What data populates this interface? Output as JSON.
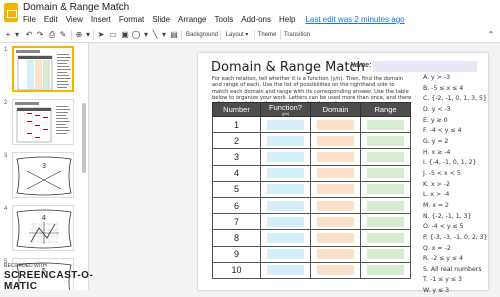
{
  "app": {
    "title": "Domain & Range Match",
    "menu": [
      "File",
      "Edit",
      "View",
      "Insert",
      "Format",
      "Slide",
      "Arrange",
      "Tools",
      "Add-ons",
      "Help"
    ],
    "last_edit": "Last edit was 2 minutes ago"
  },
  "toolbar": {
    "background": "Background",
    "layout": "Layout",
    "theme": "Theme",
    "transition": "Transition"
  },
  "filmstrip": {
    "slides": [
      {
        "number": "1",
        "selected": true
      },
      {
        "number": "2",
        "selected": false
      },
      {
        "number": "3",
        "selected": false
      },
      {
        "number": "4",
        "selected": false
      },
      {
        "number": "5",
        "selected": false
      }
    ]
  },
  "slide": {
    "title": "Domain & Range Match",
    "name_label": "Name:",
    "instructions": "For each relation, tell whether it is a function (y/n). Then, find the domain and range of each. Use the list of possibilities on the righthand side to match each domain and range with its corresponding answer. Use the table below to organize your work. Letters can be used more than once, and there will be extra letters that are not used in the end.",
    "table": {
      "headers": {
        "number": "Number",
        "function": "Function?",
        "function_sub": "(y/n)",
        "domain": "Domain",
        "range": "Range"
      },
      "rows": [
        "1",
        "2",
        "3",
        "4",
        "5",
        "6",
        "7",
        "8",
        "9",
        "10"
      ]
    },
    "answers": [
      "A. y > -3",
      "B. -5 ≤ x ≤ 4",
      "C. {-2, -1, 0, 1, 3, 5}",
      "D. y < -3",
      "E. y ≥ 0",
      "F. -4 < y ≤ 4",
      "G. y = 2",
      "H. x ≥ -4",
      "I. {-4, -1, 0, 1, 2}",
      "J. -5 < x < 5",
      "K. x > -2",
      "L. x > -4",
      "M. x = 2",
      "N. {-2, -1, 1, 3}",
      "O. -4 < y ≤ 5",
      "P. {-3, -3, -1, 0, 2, 3}",
      "Q. x = -2",
      "R. -2 ≤ y ≤ 4",
      "S. All real numbers",
      "T. -1 ≤ y ≤ 3",
      "W. y ≤ 3"
    ]
  },
  "watermark": {
    "small": "RECORDED WITH",
    "big": "SCREENCAST-O-MATIC"
  },
  "colors": {
    "function_cell": "#d5eef7",
    "domain_cell": "#fce0c9",
    "range_cell": "#d7ecd3",
    "header_bg": "#4d4d4d",
    "accent": "#f4b400"
  }
}
